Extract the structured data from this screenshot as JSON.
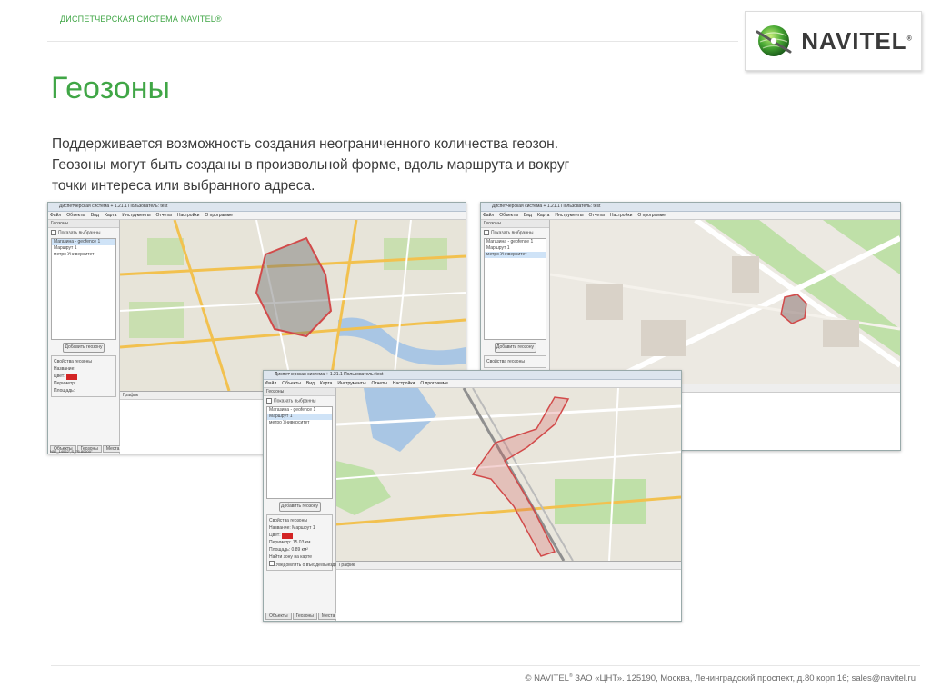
{
  "header": {
    "system_label": "ДИСПЕТЧЕРСКАЯ СИСТЕМА NAVITEL®",
    "logo_text": "NAVITEL",
    "logo_reg": "®"
  },
  "title": "Геозоны",
  "description": [
    "Поддерживается возможность создания неограниченного количества геозон.",
    "Геозоны могут быть созданы в произвольной форме, вдоль маршрута и вокруг",
    "точки интереса или выбранного адреса."
  ],
  "screens": {
    "window_title": "Диспетчерская система + 1.21.1 Пользователь: test",
    "menu": [
      "Файл",
      "Объекты",
      "Вид",
      "Карта",
      "Инструменты",
      "Отчеты",
      "Настройки",
      "О программе"
    ],
    "panel_title": "Геозоны",
    "show_selected": "Показать выбранны",
    "list_items": [
      "Магазина - geofence 1",
      "Маршрут 1",
      "метро Университет"
    ],
    "add_button": "Добавить геозону",
    "props_title": "Свойства геозоны",
    "props_name_label": "Название:",
    "props_name_value": "Маршрут 1",
    "props_color_label": "Цвет:",
    "props_perimeter_label": "Периметр:",
    "props_perimeter_value": "15.03",
    "props_perimeter_unit": "км",
    "props_area_label": "Площадь:",
    "props_area_value": "0.89",
    "props_area_unit": "км²",
    "props_find_button": "Найти зону на карте",
    "props_warn_label": "Уведомлять о въезде/выезде",
    "tabs": [
      "Объекты",
      "Геозоны",
      "Места"
    ],
    "graph_label": "График",
    "status_text": "N52_14062°,S_25.80600°"
  },
  "footer": {
    "brand": "© NAVITEL",
    "sup": "®",
    "text": " ЗАО «ЦНТ». 125190, Москва, Ленинградский проспект, д.80 корп.16; sales@navitel.ru"
  }
}
